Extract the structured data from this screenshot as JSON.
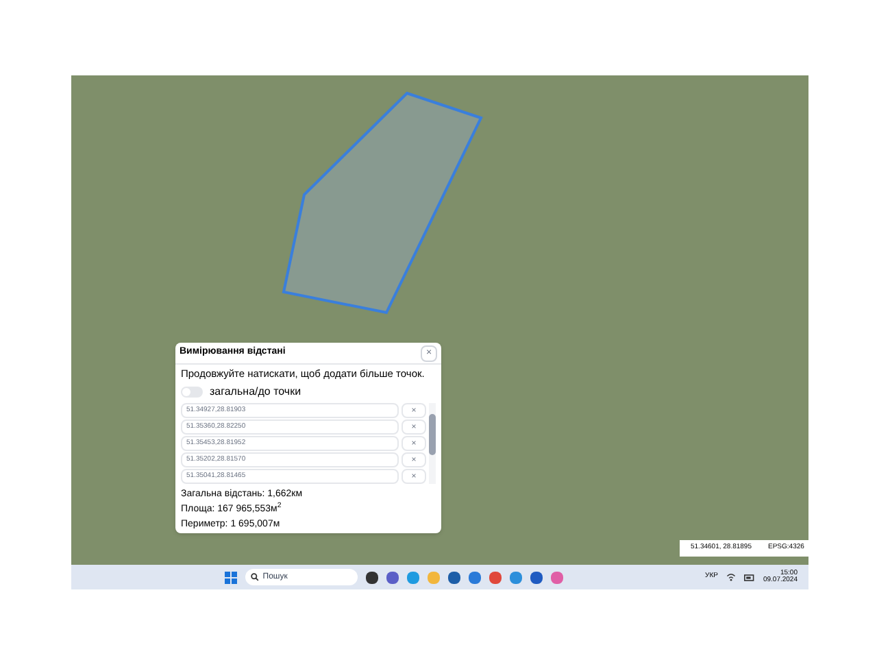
{
  "dialog": {
    "title": "Вимірювання відстані",
    "close": "×",
    "hint": "Продовжуйте натискати, щоб додати більше точок.",
    "toggle": {
      "label": "загальна/до точки",
      "on": false
    },
    "points": [
      {
        "value": "51.34927,28.81903",
        "remove": "×"
      },
      {
        "value": "51.35360,28.82250",
        "remove": "×"
      },
      {
        "value": "51.35453,28.81952",
        "remove": "×"
      },
      {
        "value": "51.35202,28.81570",
        "remove": "×"
      },
      {
        "value": "51.35041,28.81465",
        "remove": "×"
      }
    ],
    "total": "Загальна відстань: 1,662км",
    "area": "Площа: 167 965,553м$^{2}$",
    "perimeter": "Периметр: 1 695,007м"
  },
  "coordinates": {
    "position": "51.34601, 28.81895",
    "projection": "EPSG:4326"
  },
  "taskbar": {
    "search_placeholder": "Пошук",
    "language": "УКР",
    "time": "15:00",
    "date": "09.07.2024"
  }
}
